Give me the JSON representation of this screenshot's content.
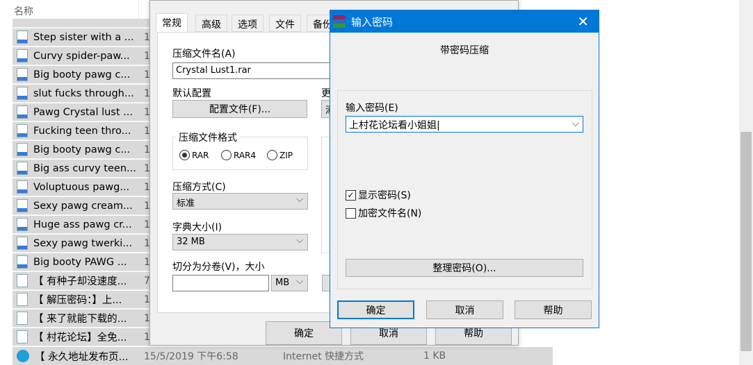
{
  "explorer": {
    "column_name": "名称",
    "rows": [
      {
        "name": "Step sister with a ...",
        "col": "1",
        "type": "mp4"
      },
      {
        "name": "Curvy spider-paw...",
        "col": "1",
        "type": "mp4"
      },
      {
        "name": "Big booty pawg c...",
        "col": "1",
        "type": "mp4"
      },
      {
        "name": "slut fucks through...",
        "col": "1",
        "type": "mp4"
      },
      {
        "name": "Pawg Crystal lust ...",
        "col": "1",
        "type": "mp4"
      },
      {
        "name": "Fucking teen thro...",
        "col": "1",
        "type": "mp4"
      },
      {
        "name": "Big booty pawg c...",
        "col": "1",
        "type": "mp4"
      },
      {
        "name": "Big ass curvy teen...",
        "col": "1",
        "type": "mp4"
      },
      {
        "name": "Voluptuous pawg...",
        "col": "1",
        "type": "mp4"
      },
      {
        "name": "Sexy pawg cream...",
        "col": "1",
        "type": "mp4"
      },
      {
        "name": "Huge ass pawg cr...",
        "col": "1",
        "type": "mp4"
      },
      {
        "name": "Sexy pawg twerki...",
        "col": "1",
        "type": "mp4"
      },
      {
        "name": "Big booty PAWG ...",
        "col": "1",
        "type": "mp4"
      },
      {
        "name": "【 有种子却没速度...",
        "col": "7",
        "type": "txt"
      },
      {
        "name": "【 解压密码：】上...",
        "col": "1",
        "type": "img"
      },
      {
        "name": "【 来了就能下载的...",
        "col": "1",
        "type": "txt"
      },
      {
        "name": "【 村花论坛】全免...",
        "col": "1",
        "type": "txt"
      }
    ],
    "last_row": {
      "name": "【 永久地址发布页...",
      "date": "15/5/2019 下午6:58",
      "type": "Internet 快捷方式",
      "size": "1 KB"
    }
  },
  "rar_dialog": {
    "tabs": [
      "常规",
      "高级",
      "选项",
      "文件",
      "备份"
    ],
    "archive_name_label": "压缩文件名(A)",
    "archive_name": "Crystal Lust1.rar",
    "default_profile_label": "默认配置",
    "profile_button": "配置文件(F)...",
    "update_label_partial": "更",
    "update_select_partial": "添",
    "format_label": "压缩文件格式",
    "formats": [
      "RAR",
      "RAR4",
      "ZIP"
    ],
    "format_selected": "RAR",
    "method_label": "压缩方式(C)",
    "method": "标准",
    "dict_label": "字典大小(I)",
    "dict": "32 MB",
    "split_label": "切分为分卷(V)，大小",
    "split_value": "",
    "split_unit": "MB",
    "ok": "确定",
    "cancel": "取消",
    "help": "帮助"
  },
  "password_dialog": {
    "title": "输入密码",
    "subtitle": "带密码压缩",
    "password_label": "输入密码(E)",
    "password": "上村花论坛看小姐姐",
    "show_password": "显示密码(S)",
    "show_password_checked": true,
    "encrypt_names": "加密文件名(N)",
    "encrypt_names_checked": false,
    "organize": "整理密码(O)...",
    "ok": "确定",
    "cancel": "取消",
    "help": "帮助",
    "accent": "#0078d7"
  }
}
